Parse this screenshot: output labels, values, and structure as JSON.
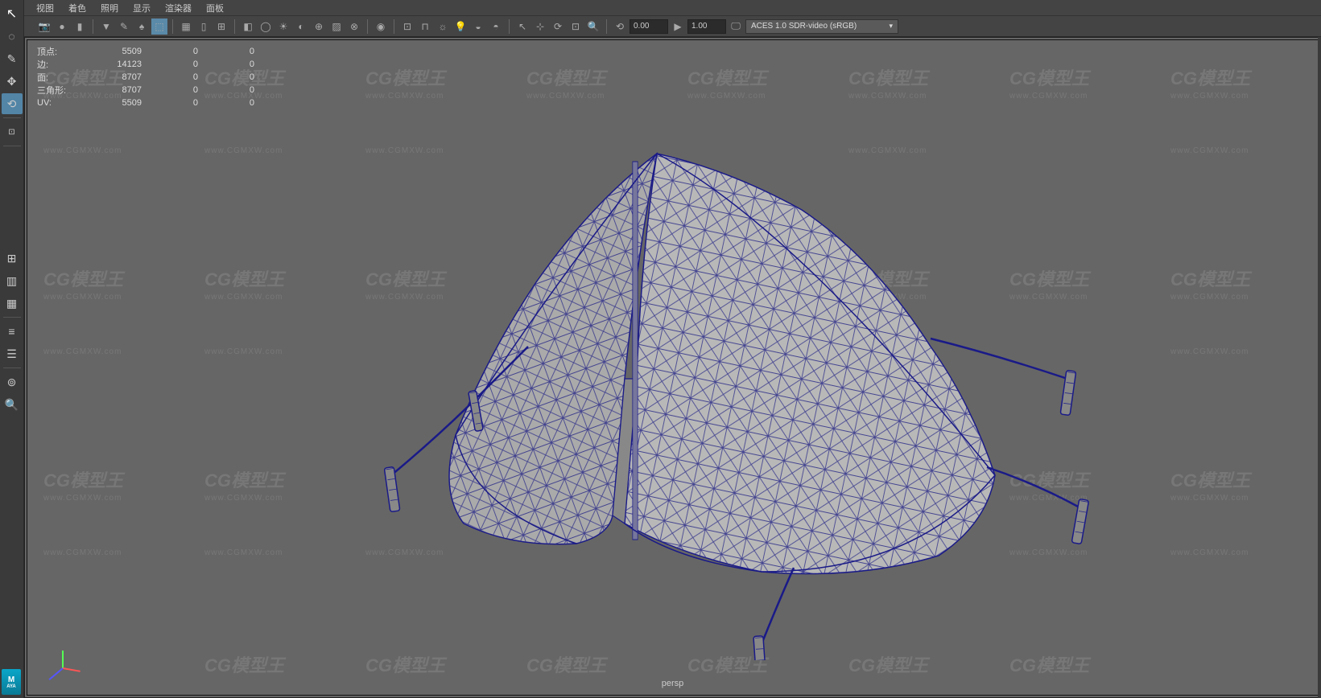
{
  "menus": {
    "view": "视图",
    "shading": "着色",
    "lighting": "照明",
    "show": "显示",
    "renderer": "渲染器",
    "panels": "面板"
  },
  "toolbar": {
    "speed_value": "0.00",
    "scale_value": "1.00",
    "color_space": "ACES 1.0 SDR-video (sRGB)"
  },
  "hud": {
    "rows": [
      {
        "label": "顶点:",
        "v1": "5509",
        "v2": "0",
        "v3": "0"
      },
      {
        "label": "边:",
        "v1": "14123",
        "v2": "0",
        "v3": "0"
      },
      {
        "label": "面:",
        "v1": "8707",
        "v2": "0",
        "v3": "0"
      },
      {
        "label": "三角形:",
        "v1": "8707",
        "v2": "0",
        "v3": "0"
      },
      {
        "label": "UV:",
        "v1": "5509",
        "v2": "0",
        "v3": "0"
      }
    ]
  },
  "camera": "persp",
  "watermark": {
    "brand": "CG模型王",
    "url": "www.CGMXW.com"
  },
  "badge": {
    "top": "M",
    "bottom": "AYA"
  }
}
